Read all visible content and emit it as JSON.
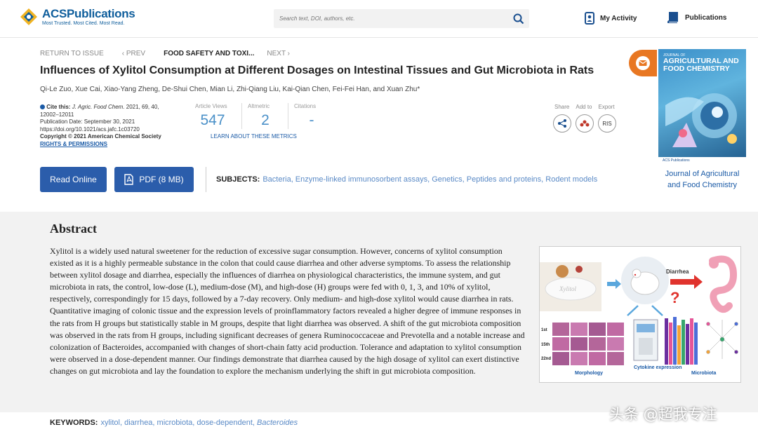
{
  "header": {
    "logo_name": "ACSPublications",
    "logo_tagline": "Most Trusted. Most Cited. Most Read.",
    "search_placeholder": "Search text, DOI, authors, etc.",
    "my_activity": "My Activity",
    "publications": "Publications"
  },
  "nav": {
    "return": "RETURN TO ISSUE",
    "prev": "‹ PREV",
    "section": "FOOD SAFETY AND TOXI...",
    "next": "NEXT ›"
  },
  "article": {
    "title": "Influences of Xylitol Consumption at Different Dosages on Intestinal Tissues and Gut Microbiota in Rats",
    "authors": "Qi-Le Zuo, Xue Cai, Xiao-Yang Zheng, De-Shui Chen, Mian Li, Zhi-Qiang Liu, Kai-Qian Chen, Fei-Fei Han, and Xuan Zhu*",
    "cite_label": "Cite this:",
    "cite_journal": "J. Agric. Food Chem.",
    "cite_ref": "2021, 69, 40,",
    "cite_pages": "12002–12011",
    "pub_date": "Publication Date: September 30, 2021",
    "doi": "https://doi.org/10.1021/acs.jafc.1c03720",
    "copyright": "Copyright © 2021 American Chemical Society",
    "rights": "RIGHTS & PERMISSIONS"
  },
  "metrics": {
    "views_label": "Article Views",
    "views": "547",
    "altmetric_label": "Altmetric",
    "altmetric": "2",
    "citations_label": "Citations",
    "citations": "-",
    "learn": "LEARN ABOUT THESE METRICS"
  },
  "share": {
    "share_label": "Share",
    "add_label": "Add to",
    "export_label": "Export",
    "export_btn": "RIS"
  },
  "actions": {
    "read_online": "Read Online",
    "pdf": "PDF (8 MB)"
  },
  "subjects": {
    "label": "SUBJECTS:",
    "list": "Bacteria, Enzyme-linked immunosorbent assays, Genetics, Peptides and proteins, Rodent models"
  },
  "journal": {
    "cover_small": "JOURNAL OF",
    "cover_name": "AGRICULTURAL AND FOOD CHEMISTRY",
    "cover_publisher": "ACS Publications",
    "title": "Journal of Agricultural and Food Chemistry"
  },
  "abstract": {
    "heading": "Abstract",
    "text": "Xylitol is a widely used natural sweetener for the reduction of excessive sugar consumption. However, concerns of xylitol consumption existed as it is a highly permeable substance in the colon that could cause diarrhea and other adverse symptoms. To assess the relationship between xylitol dosage and diarrhea, especially the influences of diarrhea on physiological characteristics, the immune system, and gut microbiota in rats, the control, low-dose (L), medium-dose (M), and high-dose (H) groups were fed with 0, 1, 3, and 10% of xylitol, respectively, correspondingly for 15 days, followed by a 7-day recovery. Only medium- and high-dose xylitol would cause diarrhea in rats. Quantitative imaging of colonic tissue and the expression levels of proinflammatory factors revealed a higher degree of immune responses in the rats from H groups but statistically stable in M groups, despite that light diarrhea was observed. A shift of the gut microbiota composition was observed in the rats from H groups, including significant decreases of genera Ruminococcaceae and Prevotella and a notable increase and colonization of Bacteroides, accompanied with changes of short-chain fatty acid production. Tolerance and adaptation to xylitol consumption were observed in a dose-dependent manner. Our findings demonstrate that diarrhea caused by the high dosage of xylitol can exert distinctive changes on gut microbiota and lay the foundation to explore the mechanism underlying the shift in gut microbiota composition."
  },
  "toc_graphic": {
    "label_xylitol": "Xylitol",
    "label_diarrhea": "Diarrhea",
    "label_1st": "1st",
    "label_15th": "15th",
    "label_22nd": "22nd",
    "label_morphology": "Morphology",
    "label_cytokine": "Cytokine expression",
    "label_microbiota": "Microbiota"
  },
  "keywords": {
    "label": "KEYWORDS:",
    "list": "xylitol, diarrhea, microbiota, dose-dependent,",
    "italic": "Bacteroides"
  },
  "watermark": "头条 @超我专注",
  "colors": {
    "brand_blue": "#2b5dab",
    "link_blue": "#5a8ac6",
    "accent_orange": "#e87722"
  }
}
